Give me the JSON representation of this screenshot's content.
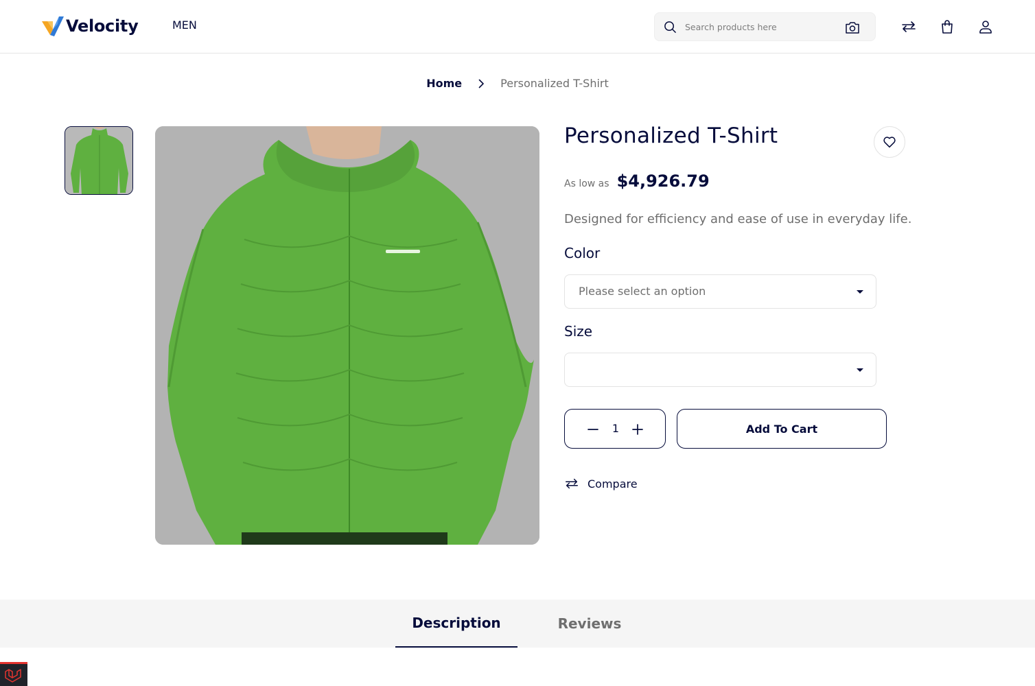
{
  "header": {
    "brand": "Velocity",
    "nav_item": "MEN",
    "search": {
      "placeholder": "Search products here",
      "value": ""
    },
    "icons": [
      "search-icon",
      "camera-icon",
      "compare-icon",
      "cart-icon",
      "account-icon"
    ]
  },
  "breadcrumb": {
    "home": "Home",
    "current": "Personalized T-Shirt"
  },
  "product": {
    "title": "Personalized T-Shirt",
    "price_label": "As low as",
    "price": "$4,926.79",
    "short_description": "Designed for efficiency and ease of use in everyday life.",
    "color_label": "Color",
    "color_select": "Please select an option",
    "size_label": "Size",
    "size_select": "",
    "quantity": "1",
    "add_to_cart": "Add To Cart",
    "compare": "Compare"
  },
  "tabs": {
    "description": "Description",
    "reviews": "Reviews",
    "active": "Description"
  },
  "colors": {
    "brand_navy": "#060c3b",
    "logo_orange": "#f5a623",
    "jacket_green": "#5fb040",
    "laravel_red": "#e3342f"
  }
}
